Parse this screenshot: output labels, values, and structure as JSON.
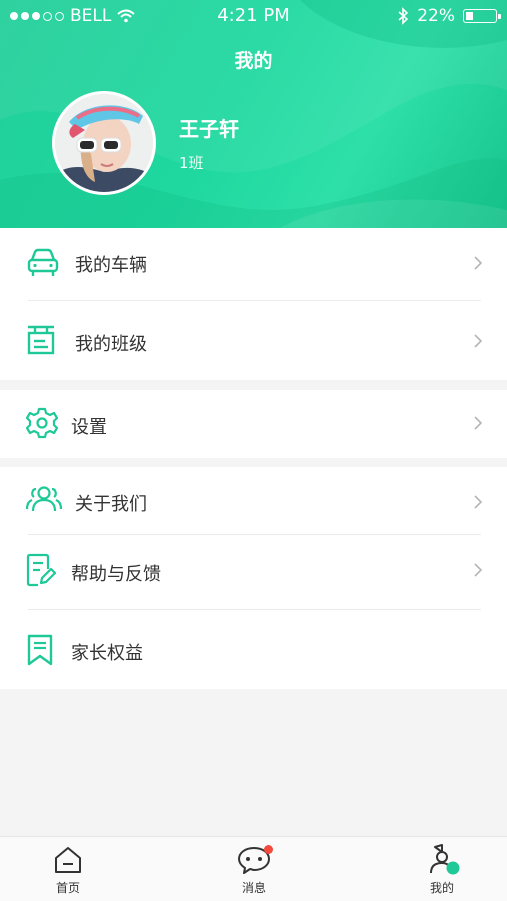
{
  "status_bar": {
    "carrier": "BELL",
    "time": "4:21 PM",
    "battery": "22%"
  },
  "header": {
    "title": "我的"
  },
  "profile": {
    "name": "王子轩",
    "class": "1班"
  },
  "menu": {
    "group1": [
      {
        "label": "我的车辆",
        "icon": "car-icon"
      },
      {
        "label": "我的班级",
        "icon": "class-board-icon"
      }
    ],
    "group2": [
      {
        "label": "设置",
        "icon": "gear-icon"
      }
    ],
    "group3": [
      {
        "label": "关于我们",
        "icon": "people-icon"
      },
      {
        "label": "帮助与反馈",
        "icon": "feedback-edit-icon"
      },
      {
        "label": "家长权益",
        "icon": "bookmark-icon"
      }
    ]
  },
  "tabbar": {
    "items": [
      {
        "label": "首页",
        "icon": "home-icon"
      },
      {
        "label": "消息",
        "icon": "chat-icon",
        "badge": true
      },
      {
        "label": "我的",
        "icon": "profile-icon",
        "active": true
      }
    ]
  },
  "colors": {
    "accent": "#1ec997",
    "badge": "#f24a3c"
  }
}
